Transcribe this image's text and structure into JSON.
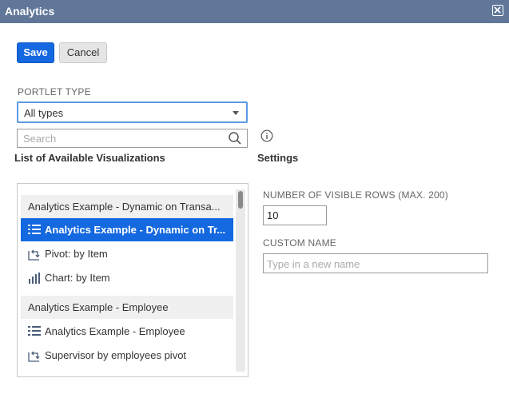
{
  "window": {
    "title": "Analytics"
  },
  "toolbar": {
    "save_label": "Save",
    "cancel_label": "Cancel"
  },
  "portlet_type": {
    "label": "PORTLET TYPE",
    "selected": "All types"
  },
  "search": {
    "placeholder": "Search"
  },
  "list": {
    "heading": "List of Available Visualizations",
    "rows": [
      {
        "kind": "group",
        "text": "Analytics Example - Dynamic on Transa..."
      },
      {
        "kind": "item",
        "icon": "table-icon",
        "text": "Analytics Example - Dynamic on Tr...",
        "selected": true
      },
      {
        "kind": "item",
        "icon": "pivot-icon",
        "text": "Pivot: by Item"
      },
      {
        "kind": "item",
        "icon": "chart-icon",
        "text": "Chart: by Item"
      },
      {
        "kind": "group",
        "text": "Analytics Example - Employee"
      },
      {
        "kind": "item",
        "icon": "table-icon",
        "text": "Analytics Example - Employee"
      },
      {
        "kind": "item",
        "icon": "pivot-icon",
        "text": "Supervisor by employees pivot"
      }
    ]
  },
  "settings": {
    "heading": "Settings",
    "visible_rows_label": "NUMBER OF VISIBLE ROWS (MAX. 200)",
    "visible_rows_value": "10",
    "custom_name_label": "CUSTOM NAME",
    "custom_name_placeholder": "Type in a new name"
  },
  "colors": {
    "titlebar": "#607799",
    "accent": "#1468e0",
    "focus": "#5c9ae3"
  }
}
